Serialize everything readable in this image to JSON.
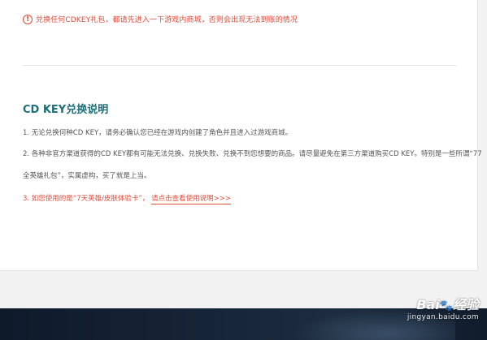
{
  "notice": {
    "icon": "exclamation-circle-icon",
    "text": "兑换任何CDKEY礼包，都请先进入一下游戏内商城，否则会出现无法到账的情况",
    "color": "#e04b3a"
  },
  "section": {
    "title": "CD KEY兑换说明",
    "title_color": "#1e6f7a",
    "line1": "1. 无论兑换何种CD KEY，请务必确认您已经在游戏内创建了角色并且进入过游戏商城。",
    "line2a": "2. 各种非官方渠道获得的CD KEY都有可能无法兑换、兑换失败、兑换不到您想要的商品。请尽量避免在第三方渠道购买CD KEY。特别是一些所谓“77",
    "line2b": "全英雄礼包”，实属虚构，买了就是上当。",
    "line3_prefix": "3. 如您使用的是“7天英雄/皮肤体验卡”，",
    "line3_link": "请点击查看使用说明>>>"
  },
  "watermark": {
    "logo_prefix": "Bai",
    "logo_paw": "🐾",
    "logo_suffix": "经验",
    "url": "jingyan.baidu.com"
  }
}
